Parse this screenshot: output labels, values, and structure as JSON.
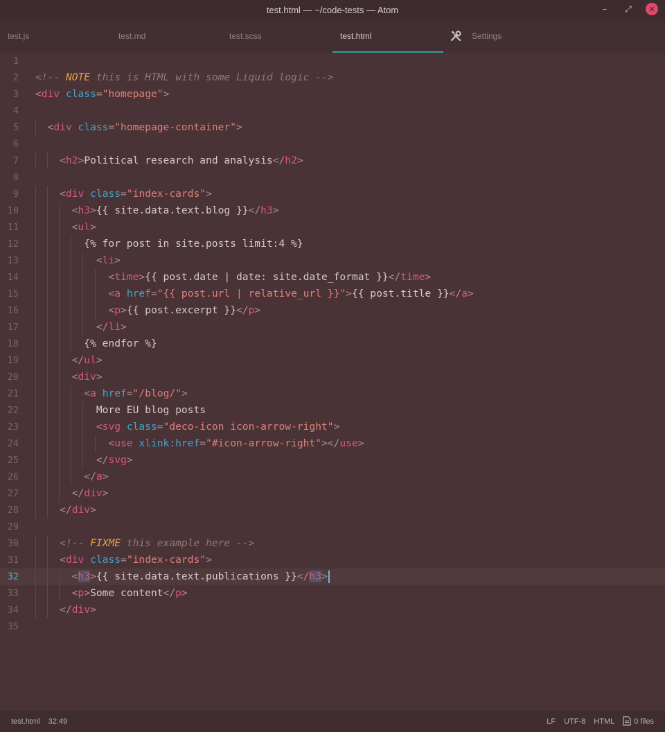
{
  "window": {
    "title": "test.html — ~/code-tests — Atom",
    "controls": {
      "minimize": "–",
      "maximize": "⤢",
      "close": "✕"
    }
  },
  "tabs": [
    {
      "label": "test.js",
      "active": false
    },
    {
      "label": "test.md",
      "active": false
    },
    {
      "label": "test.scss",
      "active": false
    },
    {
      "label": "test.html",
      "active": true
    },
    {
      "label": "Settings",
      "active": false,
      "icon": "tools-icon"
    }
  ],
  "colors": {
    "accent": "#2fa39a",
    "background": "#4a3336",
    "tag": "#d9558a",
    "attribute": "#3fa6c8",
    "string": "#e07f7a",
    "comment": "#8c7a78",
    "note": "#e0a050"
  },
  "editor": {
    "cursor_line": 32,
    "lines": [
      [],
      [
        [
          "cm",
          "<!-- "
        ],
        [
          "note",
          "NOTE"
        ],
        [
          "cm",
          " this is HTML with some Liquid logic -->"
        ]
      ],
      [
        [
          "br",
          "<"
        ],
        [
          "tag",
          "div"
        ],
        [
          "txt",
          " "
        ],
        [
          "attr",
          "class"
        ],
        [
          "br",
          "="
        ],
        [
          "str",
          "\"homepage\""
        ],
        [
          "br",
          ">"
        ]
      ],
      [],
      [
        [
          "txt",
          "  "
        ],
        [
          "br",
          "<"
        ],
        [
          "tag",
          "div"
        ],
        [
          "txt",
          " "
        ],
        [
          "attr",
          "class"
        ],
        [
          "br",
          "="
        ],
        [
          "str",
          "\"homepage-container\""
        ],
        [
          "br",
          ">"
        ]
      ],
      [],
      [
        [
          "txt",
          "    "
        ],
        [
          "br",
          "<"
        ],
        [
          "tag",
          "h2"
        ],
        [
          "br",
          ">"
        ],
        [
          "txt",
          "Political research and analysis"
        ],
        [
          "br",
          "</"
        ],
        [
          "tag",
          "h2"
        ],
        [
          "br",
          ">"
        ]
      ],
      [],
      [
        [
          "txt",
          "    "
        ],
        [
          "br",
          "<"
        ],
        [
          "tag",
          "div"
        ],
        [
          "txt",
          " "
        ],
        [
          "attr",
          "class"
        ],
        [
          "br",
          "="
        ],
        [
          "str",
          "\"index-cards\""
        ],
        [
          "br",
          ">"
        ]
      ],
      [
        [
          "txt",
          "      "
        ],
        [
          "br",
          "<"
        ],
        [
          "tag",
          "h3"
        ],
        [
          "br",
          ">"
        ],
        [
          "txt",
          "{{ site.data.text.blog }}"
        ],
        [
          "br",
          "</"
        ],
        [
          "tag",
          "h3"
        ],
        [
          "br",
          ">"
        ]
      ],
      [
        [
          "txt",
          "      "
        ],
        [
          "br",
          "<"
        ],
        [
          "tag",
          "ul"
        ],
        [
          "br",
          ">"
        ]
      ],
      [
        [
          "txt",
          "        {% for post in site.posts limit:4 %}"
        ]
      ],
      [
        [
          "txt",
          "          "
        ],
        [
          "br",
          "<"
        ],
        [
          "tag",
          "li"
        ],
        [
          "br",
          ">"
        ]
      ],
      [
        [
          "txt",
          "            "
        ],
        [
          "br",
          "<"
        ],
        [
          "tag",
          "time"
        ],
        [
          "br",
          ">"
        ],
        [
          "txt",
          "{{ post.date | date: site.date_format }}"
        ],
        [
          "br",
          "</"
        ],
        [
          "tag",
          "time"
        ],
        [
          "br",
          ">"
        ]
      ],
      [
        [
          "txt",
          "            "
        ],
        [
          "br",
          "<"
        ],
        [
          "tag",
          "a"
        ],
        [
          "txt",
          " "
        ],
        [
          "attr",
          "href"
        ],
        [
          "br",
          "="
        ],
        [
          "str",
          "\"{{ post.url | relative_url }}\""
        ],
        [
          "br",
          ">"
        ],
        [
          "txt",
          "{{ post.title }}"
        ],
        [
          "br",
          "</"
        ],
        [
          "tag",
          "a"
        ],
        [
          "br",
          ">"
        ]
      ],
      [
        [
          "txt",
          "            "
        ],
        [
          "br",
          "<"
        ],
        [
          "tag",
          "p"
        ],
        [
          "br",
          ">"
        ],
        [
          "txt",
          "{{ post.excerpt }}"
        ],
        [
          "br",
          "</"
        ],
        [
          "tag",
          "p"
        ],
        [
          "br",
          ">"
        ]
      ],
      [
        [
          "txt",
          "          "
        ],
        [
          "br",
          "</"
        ],
        [
          "tag",
          "li"
        ],
        [
          "br",
          ">"
        ]
      ],
      [
        [
          "txt",
          "        {% endfor %}"
        ]
      ],
      [
        [
          "txt",
          "      "
        ],
        [
          "br",
          "</"
        ],
        [
          "tag",
          "ul"
        ],
        [
          "br",
          ">"
        ]
      ],
      [
        [
          "txt",
          "      "
        ],
        [
          "br",
          "<"
        ],
        [
          "tag",
          "div"
        ],
        [
          "br",
          ">"
        ]
      ],
      [
        [
          "txt",
          "        "
        ],
        [
          "br",
          "<"
        ],
        [
          "tag",
          "a"
        ],
        [
          "txt",
          " "
        ],
        [
          "attr",
          "href"
        ],
        [
          "br",
          "="
        ],
        [
          "str",
          "\"/blog/\""
        ],
        [
          "br",
          ">"
        ]
      ],
      [
        [
          "txt",
          "          More EU blog posts"
        ]
      ],
      [
        [
          "txt",
          "          "
        ],
        [
          "br",
          "<"
        ],
        [
          "tag",
          "svg"
        ],
        [
          "txt",
          " "
        ],
        [
          "attr",
          "class"
        ],
        [
          "br",
          "="
        ],
        [
          "str",
          "\"deco-icon icon-arrow-right\""
        ],
        [
          "br",
          ">"
        ]
      ],
      [
        [
          "txt",
          "            "
        ],
        [
          "br",
          "<"
        ],
        [
          "tag",
          "use"
        ],
        [
          "txt",
          " "
        ],
        [
          "attr",
          "xlink:href"
        ],
        [
          "br",
          "="
        ],
        [
          "str",
          "\"#icon-arrow-right\""
        ],
        [
          "br",
          "></"
        ],
        [
          "tag",
          "use"
        ],
        [
          "br",
          ">"
        ]
      ],
      [
        [
          "txt",
          "          "
        ],
        [
          "br",
          "</"
        ],
        [
          "tag",
          "svg"
        ],
        [
          "br",
          ">"
        ]
      ],
      [
        [
          "txt",
          "        "
        ],
        [
          "br",
          "</"
        ],
        [
          "tag",
          "a"
        ],
        [
          "br",
          ">"
        ]
      ],
      [
        [
          "txt",
          "      "
        ],
        [
          "br",
          "</"
        ],
        [
          "tag",
          "div"
        ],
        [
          "br",
          ">"
        ]
      ],
      [
        [
          "txt",
          "    "
        ],
        [
          "br",
          "</"
        ],
        [
          "tag",
          "div"
        ],
        [
          "br",
          ">"
        ]
      ],
      [],
      [
        [
          "txt",
          "    "
        ],
        [
          "cm",
          "<!-- "
        ],
        [
          "note",
          "FIXME"
        ],
        [
          "cm",
          " this example here -->"
        ]
      ],
      [
        [
          "txt",
          "    "
        ],
        [
          "br",
          "<"
        ],
        [
          "tag",
          "div"
        ],
        [
          "txt",
          " "
        ],
        [
          "attr",
          "class"
        ],
        [
          "br",
          "="
        ],
        [
          "str",
          "\"index-cards\""
        ],
        [
          "br",
          ">"
        ]
      ],
      [
        [
          "txt",
          "      "
        ],
        [
          "br",
          "<"
        ],
        [
          "tag",
          "h3",
          "hl"
        ],
        [
          "br",
          ">"
        ],
        [
          "txt",
          "{{ site.data.text.publications }}"
        ],
        [
          "br",
          "</"
        ],
        [
          "tag",
          "h3",
          "hl"
        ],
        [
          "br",
          ">"
        ]
      ],
      [
        [
          "txt",
          "      "
        ],
        [
          "br",
          "<"
        ],
        [
          "tag",
          "p"
        ],
        [
          "br",
          ">"
        ],
        [
          "txt",
          "Some content"
        ],
        [
          "br",
          "</"
        ],
        [
          "tag",
          "p"
        ],
        [
          "br",
          ">"
        ]
      ],
      [
        [
          "txt",
          "    "
        ],
        [
          "br",
          "</"
        ],
        [
          "tag",
          "div"
        ],
        [
          "br",
          ">"
        ]
      ],
      []
    ]
  },
  "status": {
    "file": "test.html",
    "position": "32:49",
    "line_ending": "LF",
    "encoding": "UTF-8",
    "grammar": "HTML",
    "files": "0 files"
  }
}
